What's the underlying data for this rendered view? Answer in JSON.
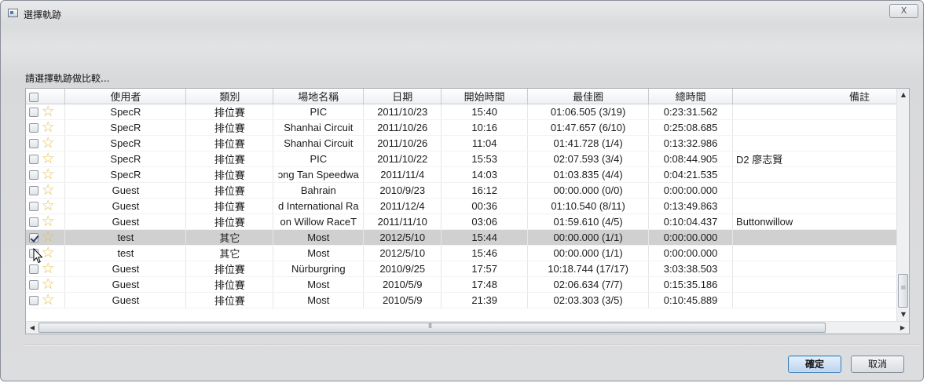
{
  "window": {
    "title": "選擇軌跡",
    "close_label": "X"
  },
  "prompt": "請選擇軌跡做比較...",
  "table": {
    "columns": [
      "",
      "使用者",
      "類別",
      "場地名稱",
      "日期",
      "開始時間",
      "最佳圈",
      "總時間",
      "備註"
    ],
    "rows": [
      {
        "checked": false,
        "selected": false,
        "user": "SpecR",
        "category": "排位賽",
        "venue": "PIC",
        "date": "2011/10/23",
        "start": "15:40",
        "best_lap": "01:06.505 (3/19)",
        "total": "0:23:31.562",
        "note": ""
      },
      {
        "checked": false,
        "selected": false,
        "user": "SpecR",
        "category": "排位賽",
        "venue": "Shanhai Circuit",
        "date": "2011/10/26",
        "start": "10:16",
        "best_lap": "01:47.657 (6/10)",
        "total": "0:25:08.685",
        "note": ""
      },
      {
        "checked": false,
        "selected": false,
        "user": "SpecR",
        "category": "排位賽",
        "venue": "Shanhai Circuit",
        "date": "2011/10/26",
        "start": "11:04",
        "best_lap": "01:41.728 (1/4)",
        "total": "0:13:32.986",
        "note": ""
      },
      {
        "checked": false,
        "selected": false,
        "user": "SpecR",
        "category": "排位賽",
        "venue": "PIC",
        "date": "2011/10/22",
        "start": "15:53",
        "best_lap": "02:07.593 (3/4)",
        "total": "0:08:44.905",
        "note": "D2 廖志賢"
      },
      {
        "checked": false,
        "selected": false,
        "user": "SpecR",
        "category": "排位賽",
        "venue": "ɔng Tan Speedwa",
        "date": "2011/11/4",
        "start": "14:03",
        "best_lap": "01:03.835 (4/4)",
        "total": "0:04:21.535",
        "note": ""
      },
      {
        "checked": false,
        "selected": false,
        "user": "Guest",
        "category": "排位賽",
        "venue": "Bahrain",
        "date": "2010/9/23",
        "start": "16:12",
        "best_lap": "00:00.000 (0/0)",
        "total": "0:00:00.000",
        "note": ""
      },
      {
        "checked": false,
        "selected": false,
        "user": "Guest",
        "category": "排位賽",
        "venue": "d International Ra",
        "date": "2011/12/4",
        "start": "00:36",
        "best_lap": "01:10.540 (8/11)",
        "total": "0:13:49.863",
        "note": ""
      },
      {
        "checked": false,
        "selected": false,
        "user": "Guest",
        "category": "排位賽",
        "venue": "on Willow RaceT",
        "date": "2011/11/10",
        "start": "03:06",
        "best_lap": "01:59.610 (4/5)",
        "total": "0:10:04.437",
        "note": "Buttonwillow"
      },
      {
        "checked": true,
        "selected": true,
        "user": "test",
        "category": "其它",
        "venue": "Most",
        "date": "2012/5/10",
        "start": "15:44",
        "best_lap": "00:00.000 (1/1)",
        "total": "0:00:00.000",
        "note": ""
      },
      {
        "checked": false,
        "selected": false,
        "user": "test",
        "category": "其它",
        "venue": "Most",
        "date": "2012/5/10",
        "start": "15:46",
        "best_lap": "00:00.000 (1/1)",
        "total": "0:00:00.000",
        "note": ""
      },
      {
        "checked": false,
        "selected": false,
        "user": "Guest",
        "category": "排位賽",
        "venue": "Nürburgring",
        "date": "2010/9/25",
        "start": "17:57",
        "best_lap": "10:18.744 (17/17)",
        "total": "3:03:38.503",
        "note": ""
      },
      {
        "checked": false,
        "selected": false,
        "user": "Guest",
        "category": "排位賽",
        "venue": "Most",
        "date": "2010/5/9",
        "start": "17:48",
        "best_lap": "02:06.634 (7/7)",
        "total": "0:15:35.186",
        "note": ""
      },
      {
        "checked": false,
        "selected": false,
        "user": "Guest",
        "category": "排位賽",
        "venue": "Most",
        "date": "2010/5/9",
        "start": "21:39",
        "best_lap": "02:03.303 (3/5)",
        "total": "0:10:45.889",
        "note": ""
      }
    ]
  },
  "scrollbars": {
    "vertical_thumb": "≡",
    "horizontal_thumb": "III"
  },
  "buttons": {
    "ok": "確定",
    "cancel": "取消"
  }
}
